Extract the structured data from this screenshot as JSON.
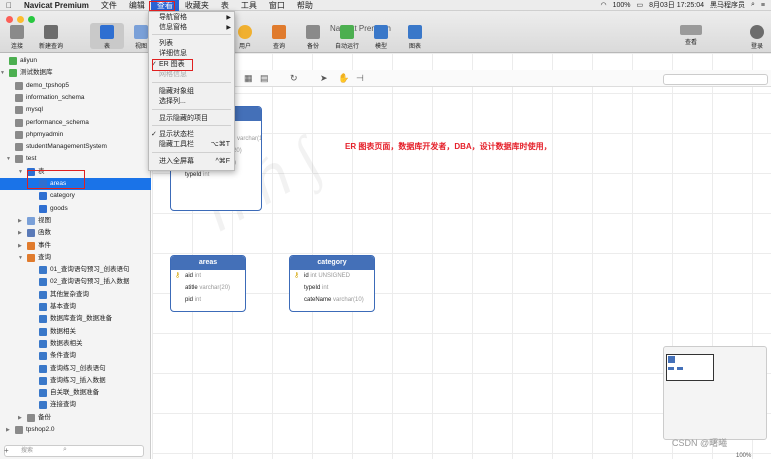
{
  "menubar": {
    "app_name": "Navicat Premium",
    "items": [
      "文件",
      "编辑",
      "查看",
      "收藏夹",
      "表",
      "工具",
      "窗口",
      "帮助"
    ],
    "status": {
      "battery": "100%",
      "datetime": "8月03日 17:25:04",
      "user": "黑马程序员"
    }
  },
  "toolbar": {
    "window_title": "Navicat Premium",
    "buttons": [
      "连接",
      "新建查询",
      "表",
      "视图",
      "用户",
      "查询",
      "备份",
      "自动运行",
      "模型",
      "图表",
      "查看",
      "登录"
    ]
  },
  "view_menu": {
    "items": [
      {
        "label": "导航窗格",
        "submenu": true
      },
      {
        "label": "信息窗格",
        "submenu": true
      },
      {
        "label": "列表"
      },
      {
        "label": "详细信息"
      },
      {
        "label": "ER 图表",
        "checked": true
      },
      {
        "label": "网格信息",
        "disabled": true
      },
      {
        "label": "隐藏对象组"
      },
      {
        "label": "选择列..."
      },
      {
        "label": "显示隐藏的项目"
      },
      {
        "label": "显示状态栏",
        "checked": true
      },
      {
        "label": "隐藏工具栏",
        "shortcut": "⌥⌘T"
      },
      {
        "label": "进入全屏幕",
        "shortcut": "^⌘F"
      }
    ]
  },
  "sidebar": {
    "items": [
      {
        "label": "aliyun",
        "level": 0,
        "icon": "connection"
      },
      {
        "label": "测试数据库",
        "level": 0,
        "icon": "connection",
        "expanded": true
      },
      {
        "label": "demo_tpshop5",
        "level": 1,
        "icon": "database"
      },
      {
        "label": "information_schema",
        "level": 1,
        "icon": "database"
      },
      {
        "label": "mysql",
        "level": 1,
        "icon": "database"
      },
      {
        "label": "performance_schema",
        "level": 1,
        "icon": "database"
      },
      {
        "label": "phpmyadmin",
        "level": 1,
        "icon": "database"
      },
      {
        "label": "studentManagementSystem",
        "level": 1,
        "icon": "database"
      },
      {
        "label": "test",
        "level": 1,
        "icon": "database",
        "expanded": true
      },
      {
        "label": "表",
        "level": 2,
        "icon": "table-group",
        "expanded": true
      },
      {
        "label": "areas",
        "level": 3,
        "icon": "table",
        "selected": true
      },
      {
        "label": "category",
        "level": 3,
        "icon": "table"
      },
      {
        "label": "goods",
        "level": 3,
        "icon": "table"
      },
      {
        "label": "视图",
        "level": 2,
        "icon": "view",
        "collapsed": true
      },
      {
        "label": "函数",
        "level": 2,
        "icon": "function",
        "collapsed": true
      },
      {
        "label": "事件",
        "level": 2,
        "icon": "event",
        "collapsed": true
      },
      {
        "label": "查询",
        "level": 2,
        "icon": "query",
        "expanded": true
      },
      {
        "label": "01_查询语句预习_创表语句",
        "level": 3,
        "icon": "query-item"
      },
      {
        "label": "02_查询语句预习_插入数据",
        "level": 3,
        "icon": "query-item"
      },
      {
        "label": "其他复杂查询",
        "level": 3,
        "icon": "query-item"
      },
      {
        "label": "基本查询",
        "level": 3,
        "icon": "query-item"
      },
      {
        "label": "数据库查询_数据准备",
        "level": 3,
        "icon": "query-item"
      },
      {
        "label": "数据相关",
        "level": 3,
        "icon": "query-item"
      },
      {
        "label": "数据表相关",
        "level": 3,
        "icon": "query-item"
      },
      {
        "label": "条件查询",
        "level": 3,
        "icon": "query-item"
      },
      {
        "label": "查询练习_创表语句",
        "level": 3,
        "icon": "query-item"
      },
      {
        "label": "查询练习_插入数据",
        "level": 3,
        "icon": "query-item"
      },
      {
        "label": "自关联_数据准备",
        "level": 3,
        "icon": "query-item"
      },
      {
        "label": "连接查询",
        "level": 3,
        "icon": "query-item"
      },
      {
        "label": "备份",
        "level": 2,
        "icon": "backup",
        "collapsed": true
      },
      {
        "label": "tpshop2.0",
        "level": 1,
        "icon": "database",
        "collapsed": true
      }
    ],
    "search_placeholder": "搜索"
  },
  "er_tables": {
    "goods": {
      "fields": [
        {
          "name": "",
          "type": ""
        },
        {
          "name": "",
          "type": "varchar(10)"
        },
        {
          "name": "company",
          "type": "varchar(20)"
        },
        {
          "name": "remark",
          "type": "varchar(20)"
        },
        {
          "name": "typeId",
          "type": "int"
        }
      ]
    },
    "areas": {
      "title": "areas",
      "fields": [
        {
          "name": "aid",
          "type": "int",
          "key": true
        },
        {
          "name": "atitle",
          "type": "varchar(20)"
        },
        {
          "name": "pid",
          "type": "int"
        }
      ]
    },
    "category": {
      "title": "category",
      "fields": [
        {
          "name": "id",
          "type": "int UNSIGNED",
          "key": true
        },
        {
          "name": "typeId",
          "type": "int"
        },
        {
          "name": "cateName",
          "type": "varchar(10)"
        }
      ]
    }
  },
  "annotation": "ER 图表页面，数据库开发者，DBA，设计数据库时使用，",
  "status": {
    "zoom": "100%",
    "watermark": "CSDN @曙曦"
  },
  "colors": {
    "accent": "#2b63d4",
    "table_header": "#4470b8",
    "annotation": "#e5202a"
  }
}
